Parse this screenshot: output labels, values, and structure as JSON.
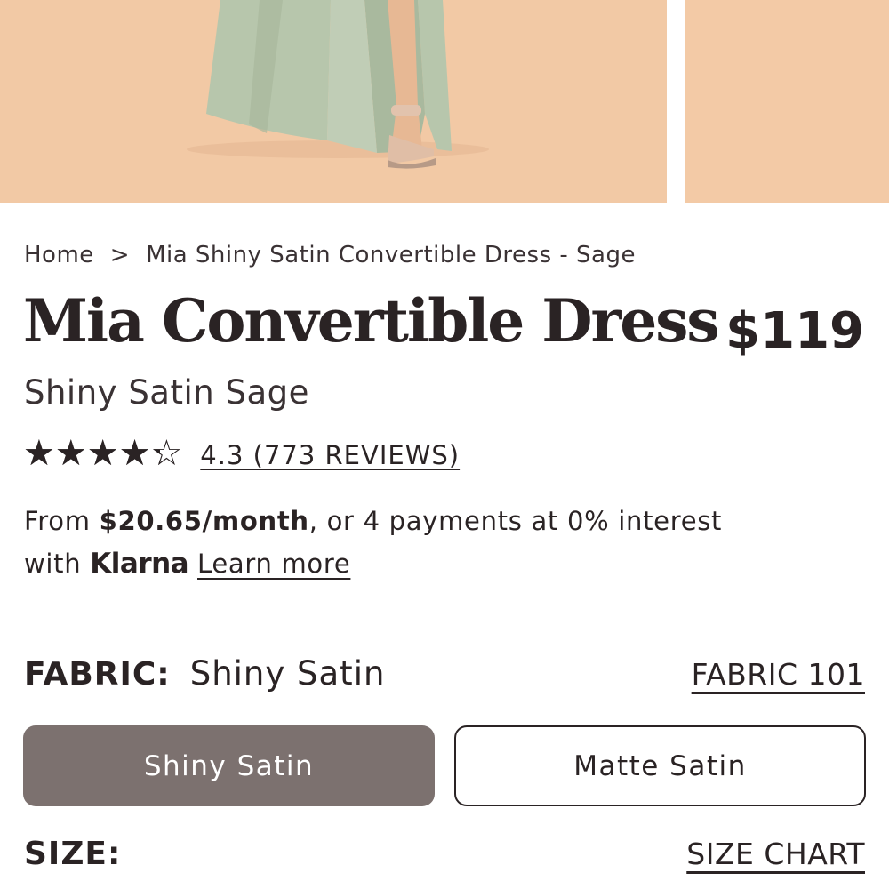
{
  "breadcrumb": {
    "home": "Home",
    "separator": ">",
    "current": "Mia Shiny Satin Convertible Dress - Sage"
  },
  "product": {
    "title": "Mia Convertible Dress",
    "price": "$119",
    "subtitle": "Shiny Satin Sage"
  },
  "rating": {
    "value": 4.3,
    "max": 5,
    "reviews_label": "4.3 (773 REVIEWS)"
  },
  "klarna": {
    "from": "From ",
    "monthly": "$20.65/month",
    "rest": ", or 4 payments at 0% interest",
    "with": "with ",
    "brand": "Klarna",
    "learn_more": "Learn more"
  },
  "fabric": {
    "label": "FABRIC:",
    "selected": "Shiny Satin",
    "guide_link": "FABRIC 101",
    "options": [
      "Shiny Satin",
      "Matte Satin"
    ]
  },
  "size": {
    "label": "SIZE:",
    "chart_link": "SIZE CHART"
  },
  "colors": {
    "photo_background": "#f2c9a5",
    "dress_sage": "#b7c6ac",
    "selected_option": "#7c716f",
    "text": "#2a2324"
  }
}
